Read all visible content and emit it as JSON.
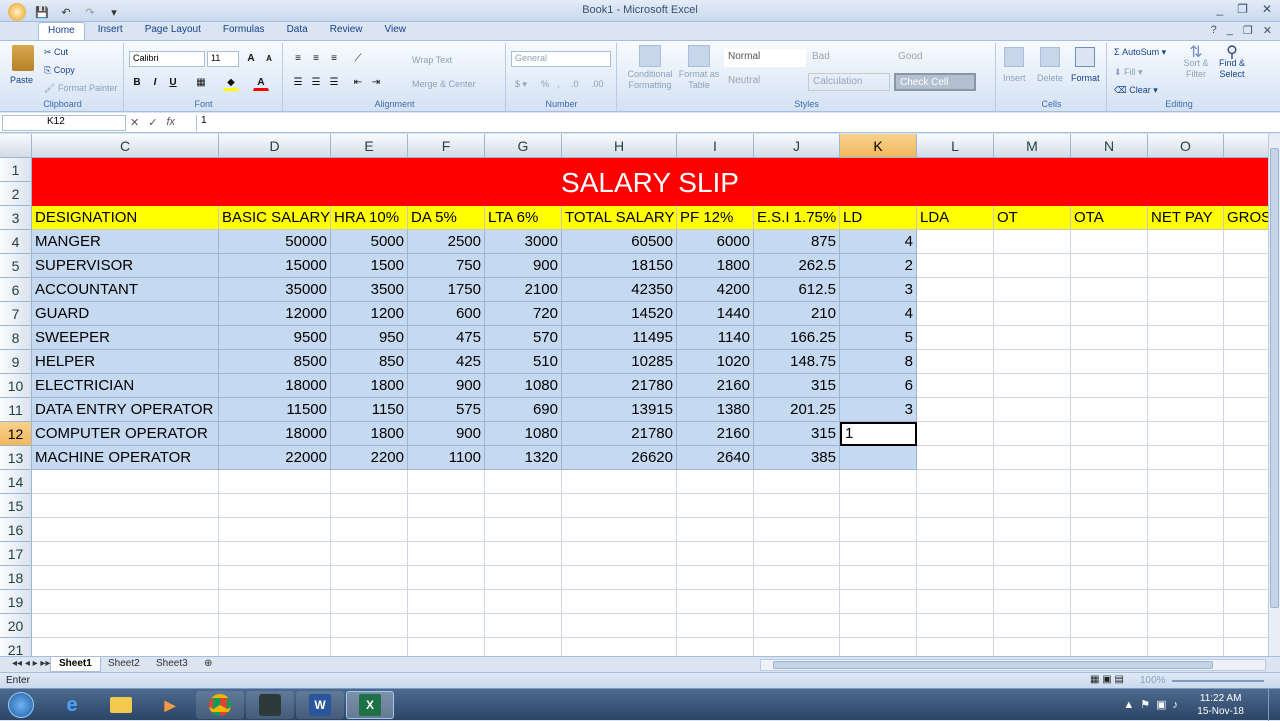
{
  "window": {
    "title": "Book1 - Microsoft Excel",
    "minimize": "_",
    "restore": "❐",
    "close": "✕"
  },
  "ribbon_tabs": [
    "Home",
    "Insert",
    "Page Layout",
    "Formulas",
    "Data",
    "Review",
    "View"
  ],
  "clipboard": {
    "paste": "Paste",
    "cut": "Cut",
    "copy": "Copy",
    "format_painter": "Format Painter",
    "title": "Clipboard"
  },
  "font": {
    "name": "Calibri",
    "size": "11",
    "title": "Font",
    "bold": "B",
    "italic": "I",
    "underline": "U"
  },
  "alignment": {
    "wrap": "Wrap Text",
    "merge": "Merge & Center",
    "title": "Alignment"
  },
  "number": {
    "format": "General",
    "title": "Number"
  },
  "styles": {
    "conditional": "Conditional Formatting",
    "format_table": "Format as Table",
    "normal": "Normal",
    "bad": "Bad",
    "good": "Good",
    "neutral": "Neutral",
    "calculation": "Calculation",
    "check_cell": "Check Cell",
    "title": "Styles"
  },
  "cells": {
    "insert": "Insert",
    "delete": "Delete",
    "format": "Format",
    "title": "Cells"
  },
  "editing": {
    "autosum": "AutoSum",
    "fill": "Fill",
    "clear": "Clear",
    "sort": "Sort & Filter",
    "find": "Find & Select",
    "title": "Editing"
  },
  "formula_bar": {
    "name_box": "K12",
    "value": "1",
    "fx": "fx"
  },
  "columns": [
    "C",
    "D",
    "E",
    "F",
    "G",
    "H",
    "I",
    "J",
    "K",
    "L",
    "M",
    "N",
    "O",
    ""
  ],
  "rows": [
    "1",
    "2",
    "3",
    "4",
    "5",
    "6",
    "7",
    "8",
    "9",
    "10",
    "11",
    "12",
    "13",
    "14",
    "15",
    "16",
    "17",
    "18",
    "19",
    "20",
    "21"
  ],
  "banner": "SALARY SLIP",
  "headers": [
    "DESIGNATION",
    "BASIC SALARY",
    "HRA 10%",
    "DA 5%",
    "LTA 6%",
    "TOTAL SALARY",
    "PF 12%",
    "E.S.I 1.75%",
    "LD",
    "LDA",
    "OT",
    "OTA",
    "NET PAY",
    "GROS"
  ],
  "data_rows": [
    [
      "MANGER",
      "50000",
      "5000",
      "2500",
      "3000",
      "60500",
      "6000",
      "875",
      "4"
    ],
    [
      "SUPERVISOR",
      "15000",
      "1500",
      "750",
      "900",
      "18150",
      "1800",
      "262.5",
      "2"
    ],
    [
      "ACCOUNTANT",
      "35000",
      "3500",
      "1750",
      "2100",
      "42350",
      "4200",
      "612.5",
      "3"
    ],
    [
      "GUARD",
      "12000",
      "1200",
      "600",
      "720",
      "14520",
      "1440",
      "210",
      "4"
    ],
    [
      "SWEEPER",
      "9500",
      "950",
      "475",
      "570",
      "11495",
      "1140",
      "166.25",
      "5"
    ],
    [
      "HELPER",
      "8500",
      "850",
      "425",
      "510",
      "10285",
      "1020",
      "148.75",
      "8"
    ],
    [
      "ELECTRICIAN",
      "18000",
      "1800",
      "900",
      "1080",
      "21780",
      "2160",
      "315",
      "6"
    ],
    [
      "DATA ENTRY OPERATOR",
      "11500",
      "1150",
      "575",
      "690",
      "13915",
      "1380",
      "201.25",
      "3"
    ],
    [
      "COMPUTER OPERATOR",
      "18000",
      "1800",
      "900",
      "1080",
      "21780",
      "2160",
      "315",
      "1"
    ],
    [
      "MACHINE OPERATOR",
      "22000",
      "2200",
      "1100",
      "1320",
      "26620",
      "2640",
      "385",
      ""
    ]
  ],
  "sheets": [
    "Sheet1",
    "Sheet2",
    "Sheet3"
  ],
  "status": {
    "mode": "Enter",
    "zoom": "100%"
  },
  "clock": {
    "time": "11:22 AM",
    "date": "15-Nov-18"
  },
  "taskbar": [
    "start",
    "ie",
    "explorer",
    "media",
    "chrome",
    "app",
    "word",
    "excel"
  ]
}
